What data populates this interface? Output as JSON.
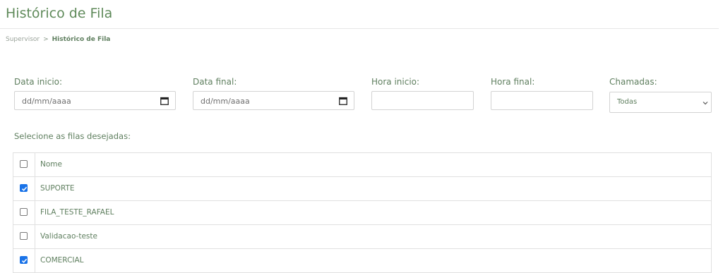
{
  "page": {
    "title": "Histórico de Fila"
  },
  "breadcrumb": {
    "parent": "Supervisor",
    "separator": ">",
    "current": "Histórico de Fila"
  },
  "filters": {
    "data_inicio": {
      "label": "Data inicio:",
      "value": "dd/mm/aaaa",
      "icon": "calendar-icon"
    },
    "data_final": {
      "label": "Data final:",
      "value": "dd/mm/aaaa",
      "icon": "calendar-icon"
    },
    "hora_inicio": {
      "label": "Hora inicio:",
      "value": ""
    },
    "hora_final": {
      "label": "Hora final:",
      "value": ""
    },
    "chamadas": {
      "label": "Chamadas:",
      "selected": "Todas",
      "icon": "chevron-down-icon"
    }
  },
  "queues": {
    "section_label": "Selecione as filas desejadas:",
    "header": {
      "name": "Nome",
      "checked": false
    },
    "rows": [
      {
        "name": "SUPORTE",
        "checked": true
      },
      {
        "name": "FILA_TESTE_RAFAEL",
        "checked": false
      },
      {
        "name": "Validacao-teste",
        "checked": false
      },
      {
        "name": "COMERCIAL",
        "checked": true
      }
    ]
  },
  "colors": {
    "accent_green": "#5f8a5a",
    "checkbox_checked": "#1a73e8",
    "border": "#d3d3d3"
  }
}
